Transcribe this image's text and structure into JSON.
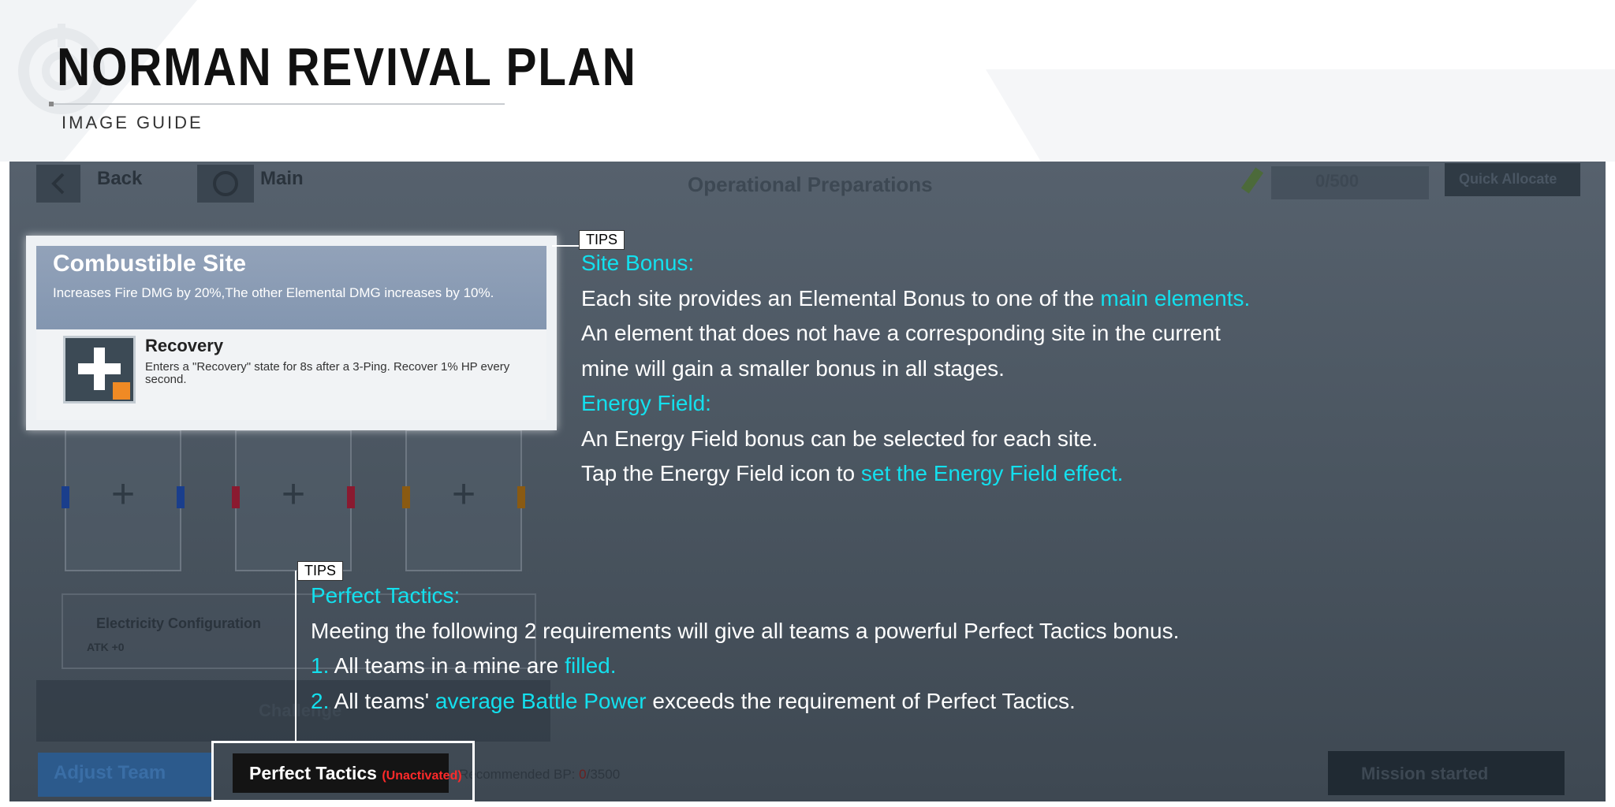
{
  "header": {
    "title": "NORMAN REVIVAL PLAN",
    "subtitle": "IMAGE GUIDE"
  },
  "game": {
    "back_label": "Back",
    "main_label": "Main",
    "screen_title": "Operational Preparations",
    "counter": "0/500",
    "quick_allocate": "Quick Allocate",
    "config_label": "Electricity Configuration",
    "config_sub": "ATK +0",
    "challenge_label": "Challenge",
    "adjust_team": "Adjust Team",
    "recommended_bp_prefix": "Recommended BP: ",
    "recommended_bp_current": "0",
    "recommended_bp_total": "/3500",
    "mission_started": "Mission started"
  },
  "site_card": {
    "title": "Combustible Site",
    "description": "Increases Fire DMG by 20%,The other Elemental DMG increases by 10%.",
    "skill_title": "Recovery",
    "skill_desc": "Enters a \"Recovery\" state for 8s after a 3-Ping. Recover 1% HP every second."
  },
  "tips1": {
    "tag": "TIPS",
    "heading1": "Site Bonus:",
    "line1_a": "Each site provides an Elemental Bonus to one of the ",
    "line1_b": "main elements.",
    "line2": "An element that does not have a corresponding site in the current",
    "line3": "mine will gain a smaller bonus in all stages.",
    "heading2": "Energy Field:",
    "line4": "An Energy Field bonus can be selected for each site.",
    "line5_a": "Tap the Energy Field icon to ",
    "line5_b": "set the Energy Field effect."
  },
  "tips2": {
    "tag": "TIPS",
    "heading": "Perfect Tactics:",
    "line1": "Meeting the following 2 requirements will give all teams a powerful Perfect Tactics bonus.",
    "line2_num": "1.",
    "line2_a": " All teams in a mine are ",
    "line2_b": "filled.",
    "line3_num": "2.",
    "line3_a": " All teams' ",
    "line3_b": "average Battle Power",
    "line3_c": " exceeds the requirement of Perfect Tactics."
  },
  "perfect_tactics_button": {
    "label": "Perfect Tactics",
    "status": "(Unactivated)"
  },
  "colors": {
    "highlight": "#13e0ee",
    "inactive": "#ff2a2a"
  }
}
